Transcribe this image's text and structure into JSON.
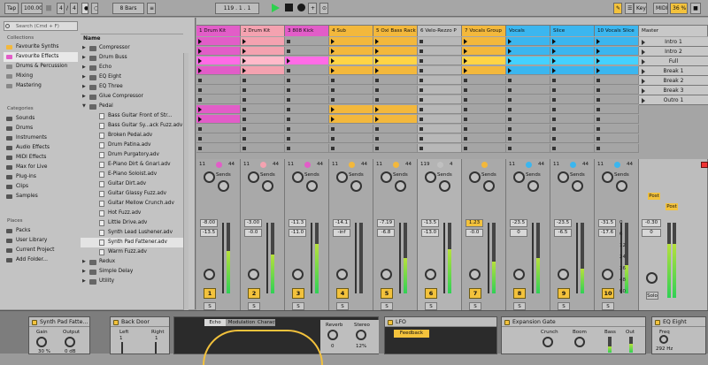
{
  "transport": {
    "tap": "Tap",
    "tempo": "100.00",
    "sig_num": "4",
    "sig_den": "4",
    "quantize": "8 Bars",
    "position": "119 . 1 . 1",
    "key_label": "Key",
    "midi_label": "MIDI",
    "cpu": "36 %"
  },
  "browser": {
    "search_placeholder": "Search (Cmd + F)",
    "collections_label": "Collections",
    "collections": [
      "Favourite Synths",
      "Favourite Effects",
      "Drums & Percussion",
      "Mixing",
      "Mastering"
    ],
    "categories_label": "Categories",
    "categories": [
      "Sounds",
      "Drums",
      "Instruments",
      "Audio Effects",
      "MIDI Effects",
      "Max for Live",
      "Plug-ins",
      "Clips",
      "Samples"
    ],
    "places_label": "Places",
    "places": [
      "Packs",
      "User Library",
      "Current Project",
      "Add Folder..."
    ],
    "name_header": "Name",
    "folders_top": [
      "Compressor",
      "Drum Buss",
      "Echo",
      "EQ Eight",
      "EQ Three",
      "Glue Compressor",
      "Pedal"
    ],
    "files": [
      "Bass Guitar Front of Str...",
      "Bass Guitar Sy...ack Fuzz.adv",
      "Broken Pedal.adv",
      "Drum Patina.adv",
      "Drum Purgatory.adv",
      "E-Piano Dirt & Gnarl.adv",
      "E-Piano Soloist.adv",
      "Guitar Dirt.adv",
      "Guitar Glassy Fuzz.adv",
      "Guitar Mellow Crunch.adv",
      "Hot Fuzz.adv",
      "Little Drive.adv",
      "Synth Lead Lushener.adv",
      "Synth Pad Fattener.adv",
      "Warm Fuzz.adv"
    ],
    "folders_bottom": [
      "Redux",
      "Simple Delay",
      "Utility"
    ]
  },
  "tracks": [
    {
      "name": "1 Drum Kit",
      "color": "#e25dc8",
      "num": "1",
      "vol": "-8.00",
      "vol2": "-13.5",
      "in": "11",
      "out": "44"
    },
    {
      "name": "2 Drum Kit",
      "color": "#f4a2b0",
      "num": "2",
      "vol": "-3.00",
      "vol2": "-0.0",
      "in": "11",
      "out": "44"
    },
    {
      "name": "3 808 Kick",
      "color": "#e25dc8",
      "num": "3",
      "vol": "-11.3",
      "vol2": "-11.0",
      "in": "11",
      "out": "44"
    },
    {
      "name": "4 Sub",
      "color": "#f3b83c",
      "num": "4",
      "vol": "-14.1",
      "vol2": "-inf",
      "in": "11",
      "out": "44"
    },
    {
      "name": "5 Oxi Bass Rack",
      "color": "#f3b83c",
      "num": "5",
      "vol": "-7.19",
      "vol2": "-6.8",
      "in": "11",
      "out": "44"
    },
    {
      "name": "6 Velo-Rezzo P",
      "color": "#c0c0c0",
      "num": "6",
      "vol": "-13.5",
      "vol2": "-13.0",
      "in": "119",
      "out": "4"
    },
    {
      "name": "7 Vocals Group",
      "color": "#f3b83c",
      "num": "7",
      "vol": "1.23",
      "vol2": "-0.0",
      "in": "",
      "out": ""
    },
    {
      "name": "Vocals",
      "color": "#3bb6ef",
      "num": "8",
      "vol": "-23.5",
      "vol2": "0",
      "in": "11",
      "out": "44"
    },
    {
      "name": "Slice",
      "color": "#3bb6ef",
      "num": "9",
      "vol": "-23.5",
      "vol2": "-6.5",
      "in": "11",
      "out": "44"
    },
    {
      "name": "10 Vocals Slice",
      "color": "#3bb6ef",
      "num": "10",
      "vol": "-31.5",
      "vol2": "-17.6",
      "in": "11",
      "out": "44"
    }
  ],
  "master": {
    "name": "Master",
    "vol": "-0.30",
    "vol2": "0",
    "solo": "Solo"
  },
  "scenes": [
    "Intro 1",
    "Intro 2",
    "Full",
    "Break 1",
    "Break 2",
    "Break 3",
    "Outro 1"
  ],
  "mixer": {
    "sends_label": "Sends",
    "post_label": "Post",
    "ticks": [
      "0",
      "6",
      "12",
      "24",
      "36",
      "48",
      "60"
    ]
  },
  "devices": {
    "synth_pad": {
      "title": "Synth Pad Fatte...",
      "gain": "Gain",
      "output": "Output",
      "gain_val": "30 %",
      "out_val": "0 dB"
    },
    "back_door": {
      "title": "Back Door",
      "left": "Left",
      "right": "Right",
      "val1": "1",
      "val2": "1"
    },
    "echo": {
      "tabs": [
        "Echo",
        "Modulation",
        "Character"
      ],
      "reverb": "Reverb",
      "stereo": "Stereo",
      "reverb_val": "0",
      "stereo_val": "12%"
    },
    "lfo": {
      "title": "LFO",
      "feedback": "Feedback"
    },
    "gate": {
      "title": "Expansion Gate",
      "crunch": "Crunch",
      "boom": "Boom",
      "bass": "Bass",
      "out": "Out"
    },
    "eq": {
      "title": "EQ Eight",
      "freq": "Freq",
      "freq_val": "292 Hz"
    }
  }
}
